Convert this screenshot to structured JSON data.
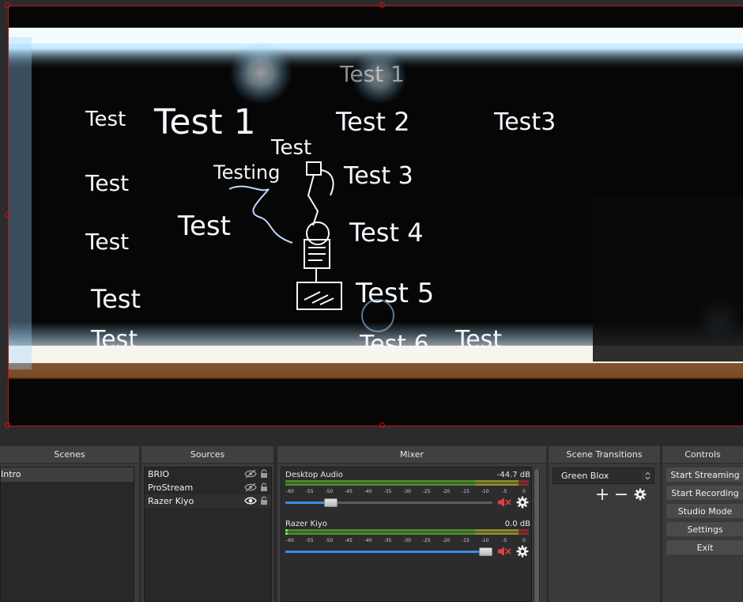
{
  "preview": {
    "board_texts": [
      "Test",
      "Test 1",
      "Test 2",
      "Test3",
      "Test",
      "Testing",
      "Test 3",
      "Test",
      "Test",
      "Test 4",
      "Test",
      "Test 5",
      "Test",
      "Test 6",
      "Test",
      "Test 1",
      "Test"
    ],
    "selection_color": "#d01010"
  },
  "scenes": {
    "title": "Scenes",
    "items": [
      "Intro"
    ]
  },
  "sources": {
    "title": "Sources",
    "items": [
      {
        "name": "BRIO",
        "visibility_icon": "eye-hidden-icon",
        "lock_icon": "lock-icon"
      },
      {
        "name": "ProStream",
        "visibility_icon": "eye-hidden-icon",
        "lock_icon": "lock-icon"
      },
      {
        "name": "Razer Kiyo",
        "visibility_icon": "eye-icon",
        "lock_icon": "lock-icon"
      }
    ]
  },
  "mixer": {
    "title": "Mixer",
    "ticks": [
      "-60",
      "-55",
      "-50",
      "-45",
      "-40",
      "-35",
      "-30",
      "-25",
      "-20",
      "-15",
      "-10",
      "-5",
      "0"
    ],
    "channels": [
      {
        "name": "Desktop Audio",
        "db": "-44.7 dB",
        "meter_level": 0.0,
        "volume": 0.2,
        "muted": true
      },
      {
        "name": "Razer Kiyo",
        "db": "0.0 dB",
        "meter_level": 0.01,
        "volume": 1.0,
        "muted": true
      }
    ]
  },
  "transitions": {
    "title": "Scene Transitions",
    "selected": "Green Blox"
  },
  "controls": {
    "title": "Controls",
    "start_streaming": "Start Streaming",
    "start_recording": "Start Recording",
    "studio_mode": "Studio Mode",
    "settings": "Settings",
    "exit": "Exit"
  },
  "colors": {
    "accent_blue": "#3c8ce6",
    "mute_red": "#e04040",
    "meter_green": "#4c8a2a",
    "meter_yellow": "#8a8a2a",
    "meter_red": "#8a2a2a"
  }
}
